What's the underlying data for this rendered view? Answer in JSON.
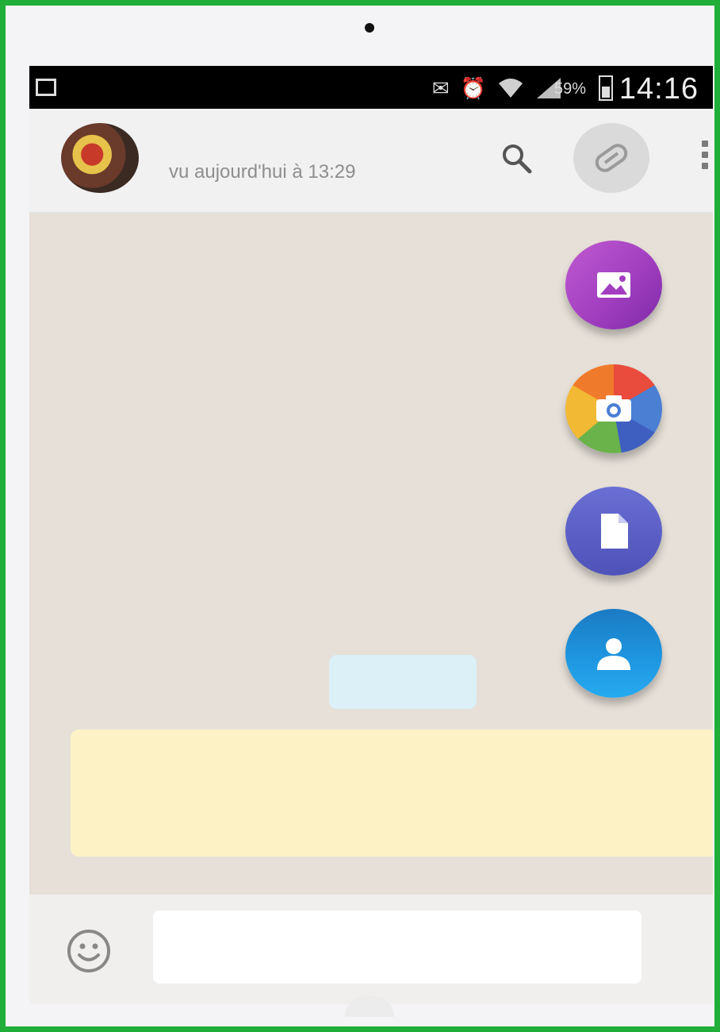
{
  "status_bar": {
    "battery": "59%",
    "time": "14:16"
  },
  "header": {
    "subtitle": "vu aujourd'hui à 13:29"
  },
  "icons": {
    "search": "search-icon",
    "attach": "paperclip-icon",
    "menu": "more-vert-icon",
    "gallery": "gallery-icon",
    "camera": "camera-icon",
    "document": "document-icon",
    "contact": "contact-icon",
    "emoji": "emoji-icon"
  },
  "colors": {
    "frame_border": "#1fae3a",
    "chat_background": "#e6e0d8",
    "gallery_fab": "#a13fc0",
    "document_fab": "#5a5ec8",
    "contact_fab": "#1f95e0",
    "outgoing_bubble": "#dcf0f8",
    "notice_bubble": "#fcf2c6"
  },
  "composer": {
    "value": "",
    "placeholder": ""
  }
}
